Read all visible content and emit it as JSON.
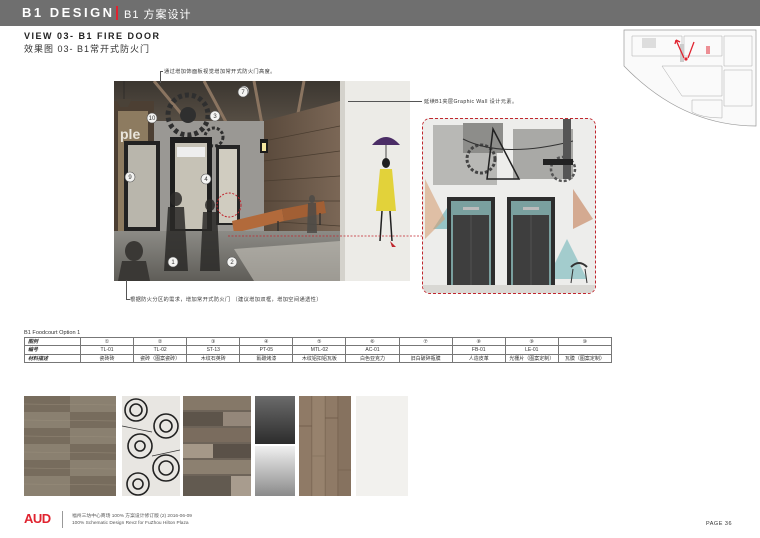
{
  "header": {
    "title": "B1 DESIGN",
    "subtitle": "B1 方案设计"
  },
  "view": {
    "title": "VIEW 03- B1 FIRE DOOR",
    "subtitle": "效果图 03- B1常开式防火门"
  },
  "render": {
    "callouts": [
      "1",
      "2",
      "3",
      "4",
      "5",
      "7",
      "9",
      "10"
    ]
  },
  "annotations": {
    "top": "通过增加饰面板视觉增加常开式防火门高度。",
    "right": "延续B1夹层Graphic Wall 设计元素。",
    "bottom": "根据防火分区的需求，增加常开式防火门 （建议增加双框，增加空间通透性）"
  },
  "table": {
    "title": "B1 Foodcourt Option 1",
    "rows": {
      "legend": {
        "label": "图例",
        "cells": [
          "①",
          "②",
          "③",
          "④",
          "⑤",
          "⑥",
          "⑦",
          "⑧",
          "⑨",
          "⑩"
        ]
      },
      "code": {
        "label": "编号",
        "cells": [
          "TL-01",
          "TL-02",
          "ST-13",
          "PT-05",
          "MTL-02",
          "AC-01",
          "",
          "FB-01",
          "LE-01",
          ""
        ]
      },
      "material": {
        "label": "材料描述",
        "cells": [
          "瓷砖砖",
          "瓷砖（图案瓷砖）",
          "木纹石英砖",
          "氟碳烤漆",
          "木纹铝扣铝瓦板",
          "白色亚克力",
          "旧白破碎瓶膜",
          "人造皮革",
          "光栅片（图案定制）",
          "瓦膜（图案定制）"
        ]
      }
    }
  },
  "swatches": [
    {
      "name": "wood-tile",
      "color": "#8a8070"
    },
    {
      "name": "pattern-tile",
      "color": "#3a3a3a"
    },
    {
      "name": "rustic-wood",
      "color": "#6e6459"
    },
    {
      "name": "metal-panel",
      "color": "#4a4a4a"
    },
    {
      "name": "wood-planks",
      "color": "#8f7a66"
    },
    {
      "name": "white-panel",
      "color": "#f2f1ee"
    }
  ],
  "footer": {
    "logo": "AUD",
    "line1": "福州三坊中心商场 100% 方案设计修订版 (2)    2016-06-09",
    "line2": "100% Schematic Design Rev2  for FuZhou Hilton Plaza",
    "page": "PAGE 36"
  },
  "colors": {
    "accent_red": "#e0232f",
    "header_gray": "#6f6f6f"
  }
}
